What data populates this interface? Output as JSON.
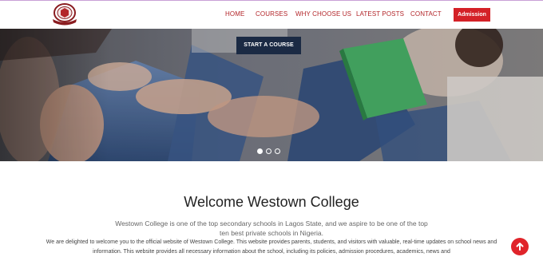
{
  "header": {
    "logo_icon": "college-crest-logo",
    "nav": [
      "HOME",
      "COURSES",
      "WHY CHOOSE US",
      "LATEST POSTS",
      "CONTACT"
    ],
    "admission_label": "Admission"
  },
  "hero": {
    "cta_label": "START A COURSE",
    "slider": {
      "slides": 3,
      "active": 1
    }
  },
  "welcome": {
    "title": "Welcome Westown College",
    "intro": "Westown College is one of the top secondary schools in Lagos State, and we aspire to be one of the top ten best private schools in Nigeria.",
    "body": "We are delighted to welcome you to the official website of Westown College. This website provides parents, students, and visitors with valuable, real-time updates on school news and information. This website provides all necessary information about the school, including its policies, admission procedures, academics, news and"
  },
  "scroll_top_icon": "arrow-up-icon",
  "colors": {
    "accent": "#b3262a",
    "button_red": "#d42127",
    "cta_navy": "#1b2a44"
  }
}
